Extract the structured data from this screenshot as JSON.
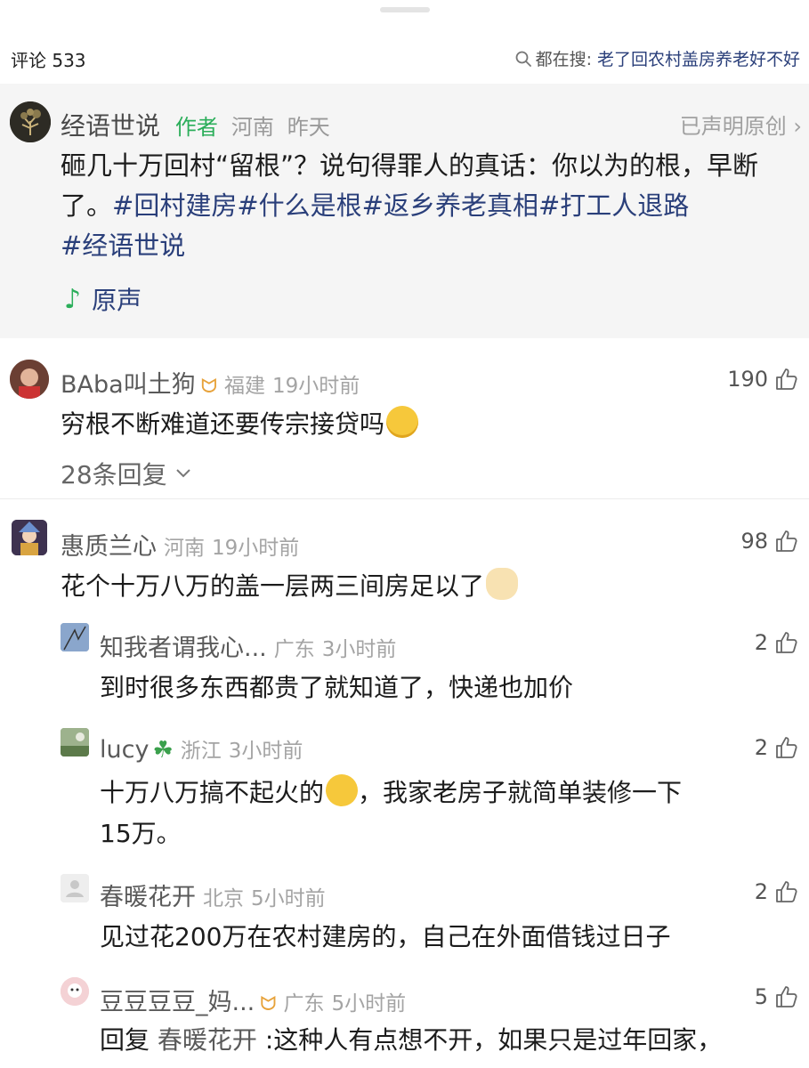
{
  "header": {
    "comments_label": "评论 533",
    "search_prefix": "都在搜:",
    "search_query": "老了回农村盖房养老好不好"
  },
  "post": {
    "author": "经语世说",
    "author_tag": "作者",
    "location": "河南",
    "time": "昨天",
    "original_label": "已声明原创 ›",
    "text_plain": "砸几十万回村“留根”？说句得罪人的真话：你以为的根，早断了。",
    "hashtags": [
      "#回村建房",
      "#什么是根",
      "#返乡养老真相",
      "#打工人退路",
      "#经语世说"
    ],
    "sound_label": "原声"
  },
  "comments": [
    {
      "name": "BAba叫土狗",
      "location": "福建",
      "time": "19小时前",
      "likes": "190",
      "text": "穷根不断难道还要传宗接贷吗",
      "replies_label": "28条回复"
    },
    {
      "name": "惠质兰心",
      "location": "河南",
      "time": "19小时前",
      "likes": "98",
      "text": "花个十万八万的盖一层两三间房足以了"
    }
  ],
  "replies": [
    {
      "name": "知我者谓我心...",
      "location": "广东",
      "time": "3小时前",
      "likes": "2",
      "text": "到时很多东西都贵了就知道了，快递也加价"
    },
    {
      "name": "lucy",
      "location": "浙江",
      "time": "3小时前",
      "likes": "2",
      "text_a": "十万八万搞不起火的",
      "text_b": "，我家老房子就简单装修一下",
      "text_c": "15万。"
    },
    {
      "name": "春暖花开",
      "location": "北京",
      "time": "5小时前",
      "likes": "2",
      "text": "见过花200万在农村建房的，自己在外面借钱过日子"
    },
    {
      "name": "豆豆豆豆_妈...",
      "location": "广东",
      "time": "5小时前",
      "likes": "5",
      "reply_prefix": "回复",
      "reply_to": "春暖花开",
      "text": ":这种人有点想不开，如果只是过年回家，"
    }
  ],
  "colors": {
    "hashtag": "#2a3f7a",
    "author_tag": "#2bae5a",
    "post_background": "#f5f5f5"
  }
}
